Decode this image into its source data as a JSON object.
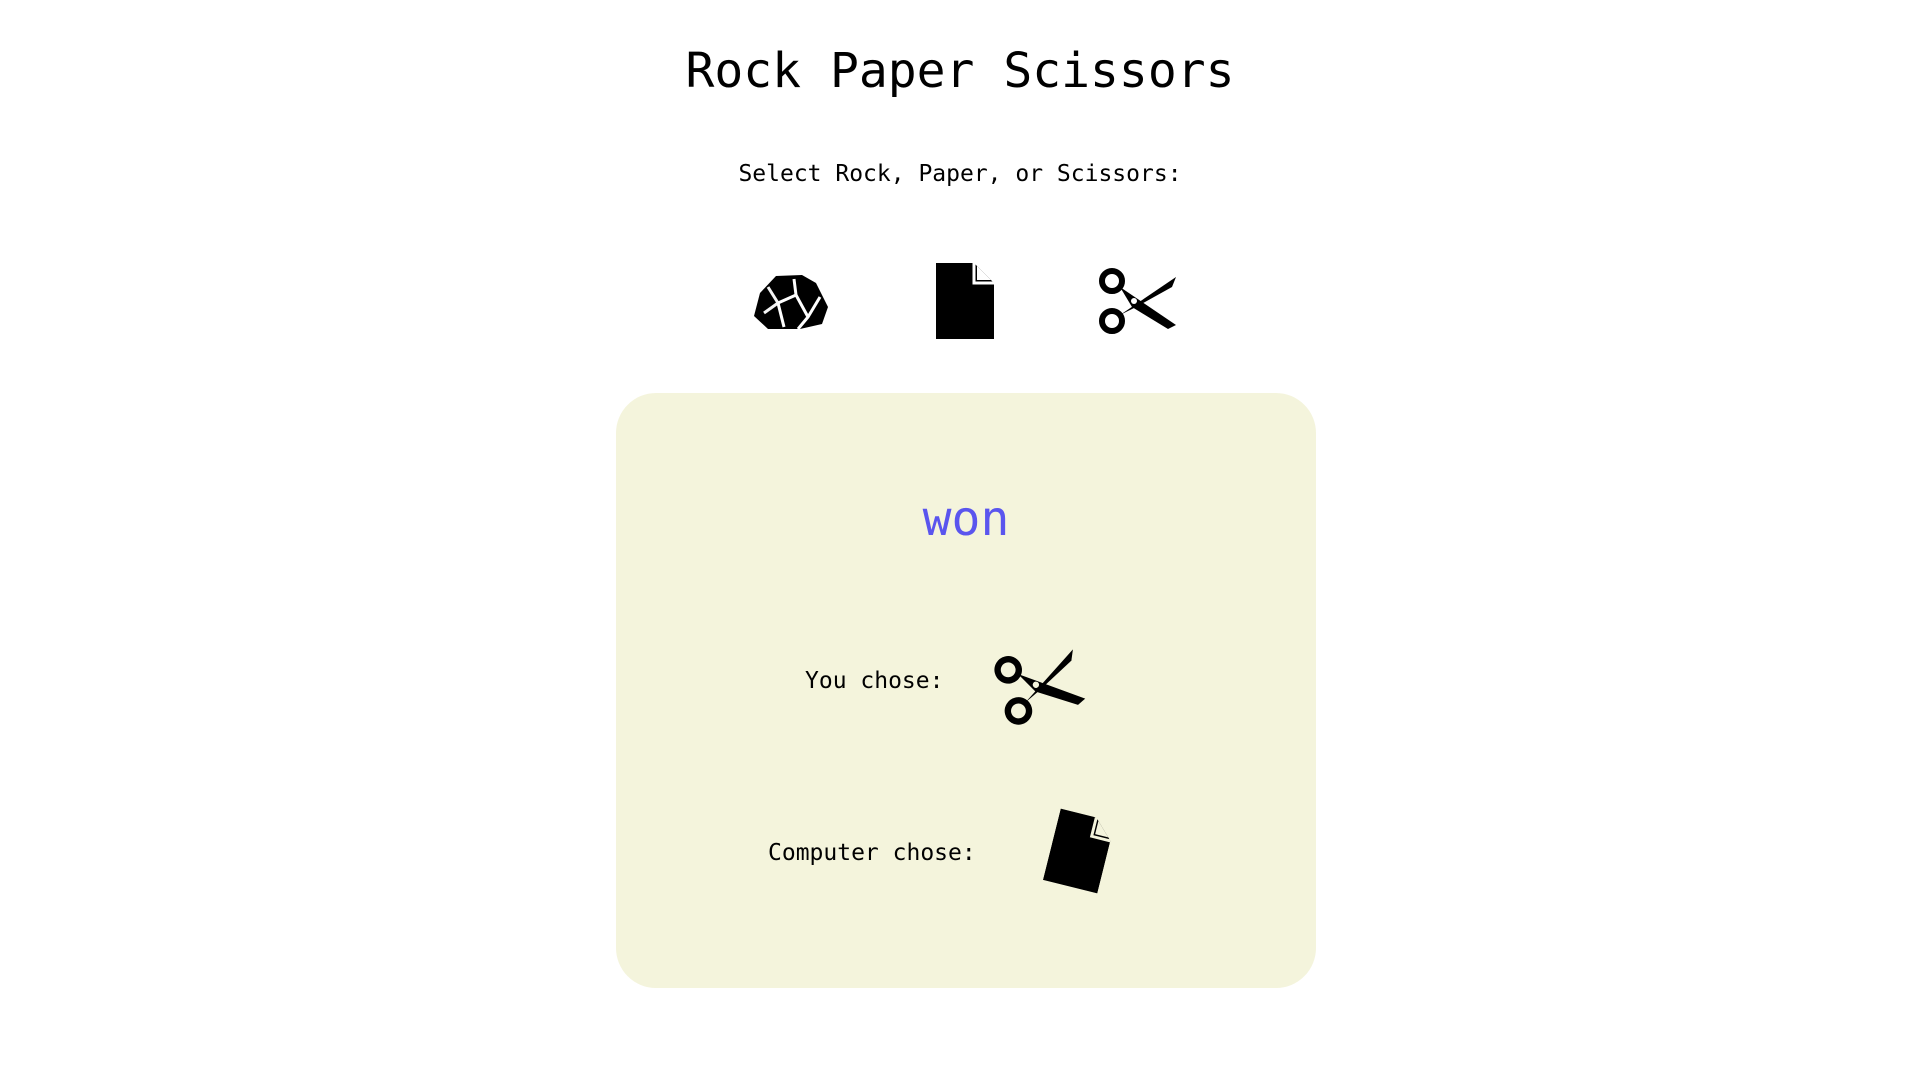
{
  "header": {
    "title": "Rock Paper Scissors",
    "prompt": "Select Rock, Paper, or Scissors:"
  },
  "choices": [
    {
      "name": "rock",
      "icon": "rock-icon"
    },
    {
      "name": "paper",
      "icon": "paper-icon"
    },
    {
      "name": "scissors",
      "icon": "scissors-icon"
    }
  ],
  "result": {
    "outcome": "won",
    "outcome_color": "#5a55ee",
    "card_color": "#f4f4dc",
    "you_label": "You chose:",
    "you_choice_icon": "scissors-icon",
    "computer_label": "Computer chose:",
    "computer_choice_icon": "paper-icon"
  }
}
